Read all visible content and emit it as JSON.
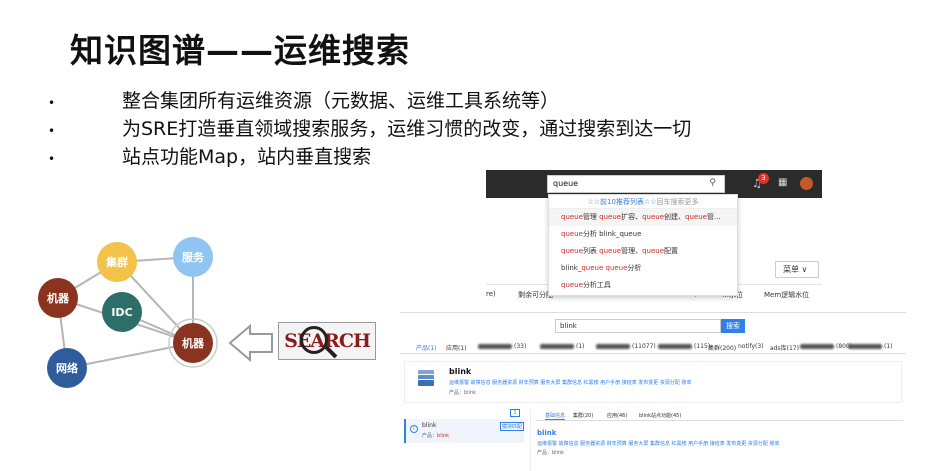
{
  "slide": {
    "title": "知识图谱——运维搜索",
    "bullets": [
      "整合集团所有运维资源（元数据、运维工具系统等）",
      "为SRE打造垂直领域搜索服务，运维习惯的改变，通过搜索到达一切",
      "站点功能Map，站内垂直搜索"
    ],
    "bullet_symbol": "•"
  },
  "graph": {
    "nodes": {
      "cluster": "集群",
      "service": "服务",
      "machine_left": "机器",
      "idc": "IDC",
      "machine_center": "机器",
      "network": "网络"
    },
    "search_label": "SEARCH",
    "colors": {
      "cluster": "#f2c24b",
      "service": "#8fc5f0",
      "machine_left": "#8a3420",
      "idc": "#2d6e68",
      "machine_center": "#8a3420",
      "network": "#2f5d9c"
    }
  },
  "screenshot1": {
    "search_value": "queue",
    "notification_count": "3",
    "dropdown_header": "☆☆前10推荐列表☆☆",
    "dropdown_hint": "回车搜索更多",
    "suggestions": [
      {
        "hl1": "queue",
        "t1": "管理 ",
        "hl2": "queue",
        "t2": "扩容、",
        "hl3": "queue",
        "t3": "创建、",
        "hl4": "queue",
        "t4": "管..."
      },
      {
        "hl1": "queue",
        "t1": "分析 blink_queue",
        "hl2": "",
        "t2": "",
        "hl3": "",
        "t3": "",
        "hl4": "",
        "t4": ""
      },
      {
        "hl1": "queue",
        "t1": "列表 ",
        "hl2": "queue",
        "t2": "管理、",
        "hl3": "queue",
        "t3": "配置",
        "hl4": "",
        "t4": ""
      },
      {
        "hl1": "",
        "t1": "blink_",
        "hl2": "queue",
        "t2": " ",
        "hl3": "queue",
        "t3": "分析",
        "hl4": "",
        "t4": ""
      },
      {
        "hl1": "queue",
        "t1": "分析工具",
        "hl2": "",
        "t2": "",
        "hl3": "",
        "t3": "",
        "hl4": "",
        "t4": ""
      }
    ],
    "menu_label": "菜单 ∨",
    "columns": [
      "re)",
      "剩余可分配",
      "ue)",
      "…水位",
      "Mem逻辑水位"
    ]
  },
  "screenshot2": {
    "search_value": "blink",
    "search_button": "搜索",
    "tabs": [
      "产品(1)",
      "应用(1)",
      "(33)",
      "(1)",
      "(11077)",
      "(115)",
      "集群(200)",
      "notify(3)",
      "ads库(17)",
      "(800)",
      "(1)"
    ],
    "card_title": "blink",
    "card_links": "运维报警  故障信息  服务器资源  财年预算  服务大屏  集群信息  红黑榜  用户手册  接班表  发布变更  资源分配  账单",
    "card_product": "产品：blink",
    "pager": "1",
    "item_name": "blink",
    "item_tag": "模块匹配",
    "item_product_label": "产品：",
    "item_product_value": "blink",
    "right_tabs": [
      "基础信息",
      "集群(20)",
      "应用(46)",
      "blink站点功能(45)"
    ],
    "right_title": "blink",
    "right_links": "运维报警  故障信息  服务器资源  财年预算  服务大屏  集群信息  红黑榜  用户手册  接班表  发布变更  资源分配  账单",
    "right_product": "产品：blink"
  }
}
